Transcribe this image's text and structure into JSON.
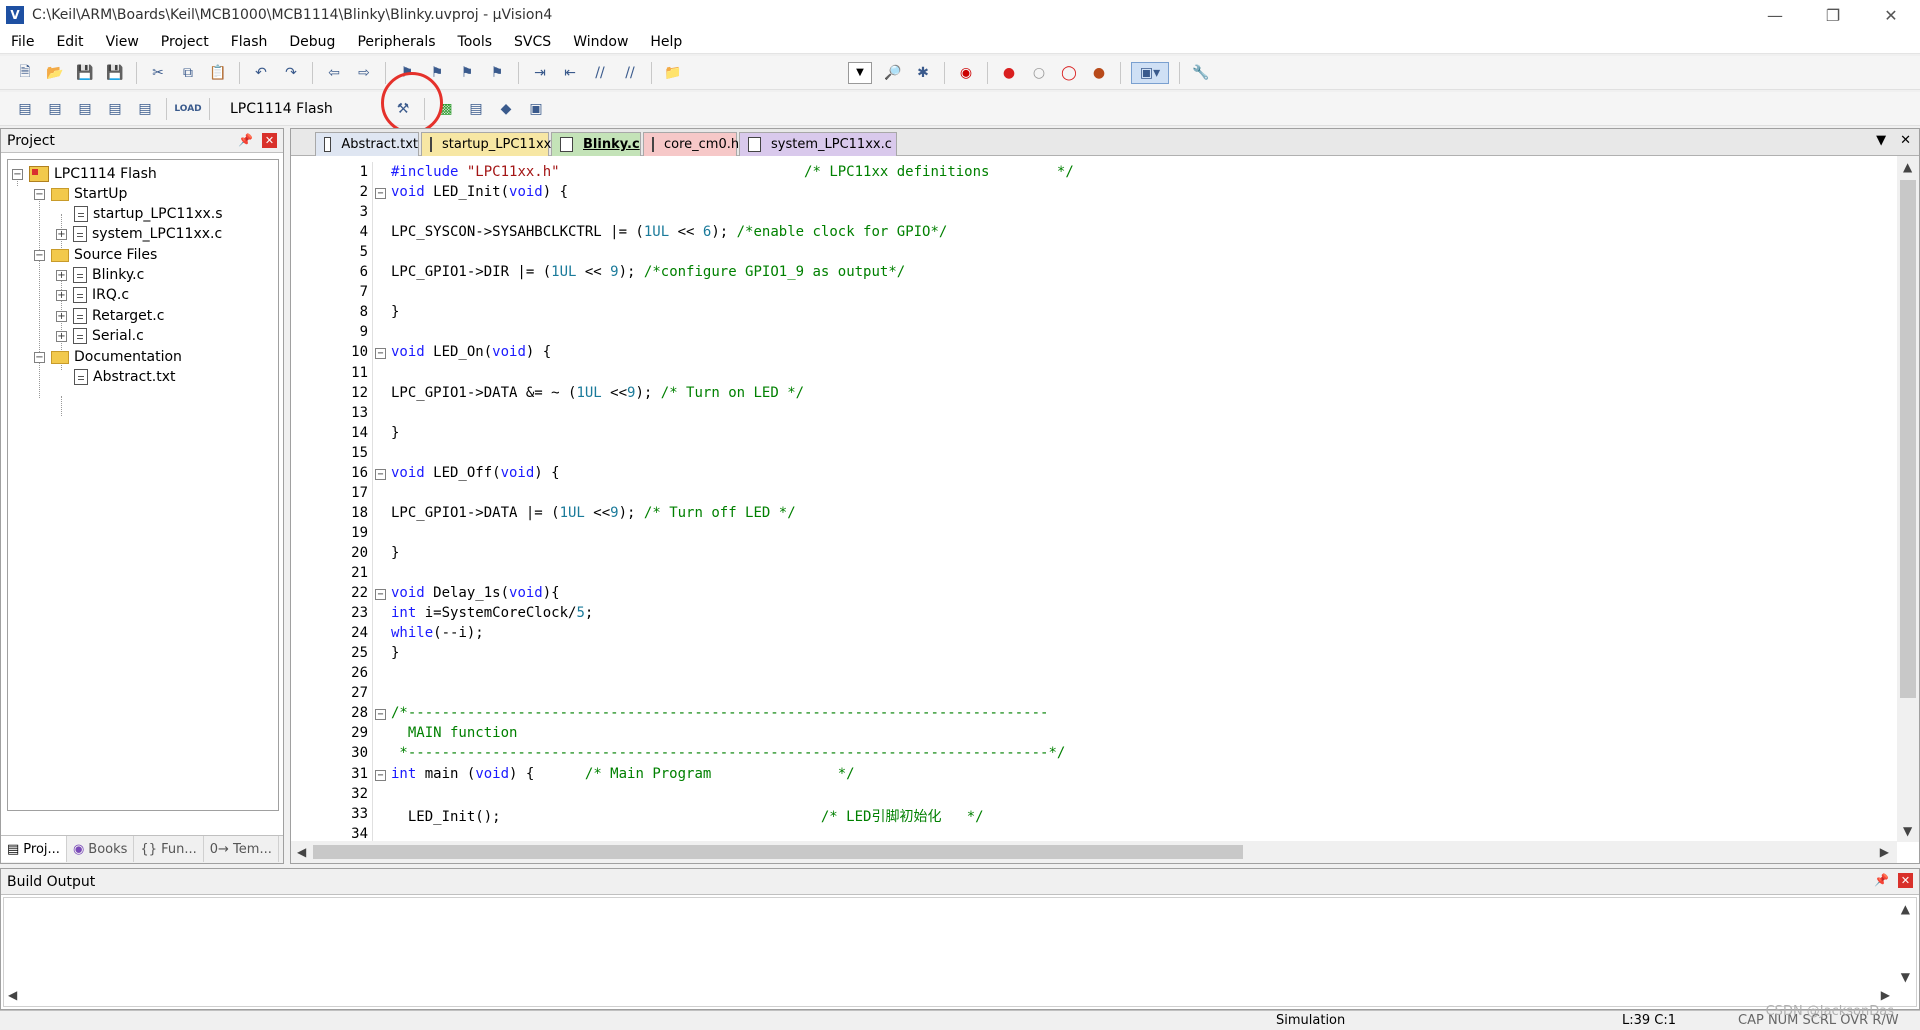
{
  "window": {
    "title": "C:\\Keil\\ARM\\Boards\\Keil\\MCB1000\\MCB1114\\Blinky\\Blinky.uvproj - µVision4",
    "icon": "keil-uv-icon"
  },
  "menu": [
    "File",
    "Edit",
    "View",
    "Project",
    "Flash",
    "Debug",
    "Peripherals",
    "Tools",
    "SVCS",
    "Window",
    "Help"
  ],
  "toolbar2": {
    "target": "LPC1114 Flash",
    "highlighted_button": "options-for-target-icon",
    "highlight_color": "#e5312b"
  },
  "project_panel": {
    "title": "Project",
    "tree": [
      {
        "label": "LPC1114 Flash",
        "type": "project"
      },
      {
        "label": "StartUp",
        "type": "folder"
      },
      {
        "label": "startup_LPC11xx.s",
        "type": "file"
      },
      {
        "label": "system_LPC11xx.c",
        "type": "file"
      },
      {
        "label": "Source Files",
        "type": "folder"
      },
      {
        "label": "Blinky.c",
        "type": "file"
      },
      {
        "label": "IRQ.c",
        "type": "file"
      },
      {
        "label": "Retarget.c",
        "type": "file"
      },
      {
        "label": "Serial.c",
        "type": "file"
      },
      {
        "label": "Documentation",
        "type": "folder"
      },
      {
        "label": "Abstract.txt",
        "type": "file"
      }
    ],
    "tabs": [
      "Proj...",
      "Books",
      "{} Fun...",
      "0→ Tem..."
    ]
  },
  "editor": {
    "tabs": [
      {
        "label": "Abstract.txt",
        "color": "#dfe6f2"
      },
      {
        "label": "startup_LPC11xx.s",
        "color": "#f7e7a4"
      },
      {
        "label": "Blinky.c",
        "color": "#c4e3b8"
      },
      {
        "label": "core_cm0.h",
        "color": "#f6c8c8"
      },
      {
        "label": "system_LPC11xx.c",
        "color": "#d9c9ec"
      }
    ],
    "active_tab": "Blinky.c",
    "lines": [
      {
        "n": "1",
        "code": "#include \"LPC11xx.h\"                             /* LPC11xx definitions        */"
      },
      {
        "n": "2",
        "code": "void LED_Init(void) {",
        "fold": true
      },
      {
        "n": "3",
        "code": ""
      },
      {
        "n": "4",
        "code": "LPC_SYSCON->SYSAHBCLKCTRL |= (1UL << 6); /*enable clock for GPIO*/"
      },
      {
        "n": "5",
        "code": ""
      },
      {
        "n": "6",
        "code": "LPC_GPIO1->DIR |= (1UL << 9); /*configure GPIO1_9 as output*/"
      },
      {
        "n": "7",
        "code": ""
      },
      {
        "n": "8",
        "code": "}"
      },
      {
        "n": "9",
        "code": ""
      },
      {
        "n": "10",
        "code": "void LED_On(void) {",
        "fold": true
      },
      {
        "n": "11",
        "code": ""
      },
      {
        "n": "12",
        "code": "LPC_GPIO1->DATA &= ~ (1UL <<9); /* Turn on LED */"
      },
      {
        "n": "13",
        "code": ""
      },
      {
        "n": "14",
        "code": "}"
      },
      {
        "n": "15",
        "code": ""
      },
      {
        "n": "16",
        "code": "void LED_Off(void) {",
        "fold": true
      },
      {
        "n": "17",
        "code": ""
      },
      {
        "n": "18",
        "code": "LPC_GPIO1->DATA |= (1UL <<9); /* Turn off LED */"
      },
      {
        "n": "19",
        "code": ""
      },
      {
        "n": "20",
        "code": "}"
      },
      {
        "n": "21",
        "code": ""
      },
      {
        "n": "22",
        "code": "void Delay_1s(void){",
        "fold": true
      },
      {
        "n": "23",
        "code": "int i=SystemCoreClock/5;"
      },
      {
        "n": "24",
        "code": "while(--i);"
      },
      {
        "n": "25",
        "code": "}"
      },
      {
        "n": "26",
        "code": ""
      },
      {
        "n": "27",
        "code": ""
      },
      {
        "n": "28",
        "code": "/*----------------------------------------------------------------------------",
        "fold": true
      },
      {
        "n": "29",
        "code": "  MAIN function"
      },
      {
        "n": "30",
        "code": " *----------------------------------------------------------------------------*/"
      },
      {
        "n": "31",
        "code": "int main (void) {      /* Main Program               */",
        "fold": true
      },
      {
        "n": "32",
        "code": ""
      },
      {
        "n": "33",
        "code": "  LED_Init();                                      /* LED引脚初始化   */"
      },
      {
        "n": "34",
        "code": ""
      }
    ]
  },
  "output_panel": {
    "title": "Build Output"
  },
  "statusbar": {
    "mode": "Simulation",
    "position": "L:39 C:1",
    "flags": "CAP  NUM  SCRL  OVR  R/W"
  },
  "watermark": "CSDN @JacksonDas"
}
